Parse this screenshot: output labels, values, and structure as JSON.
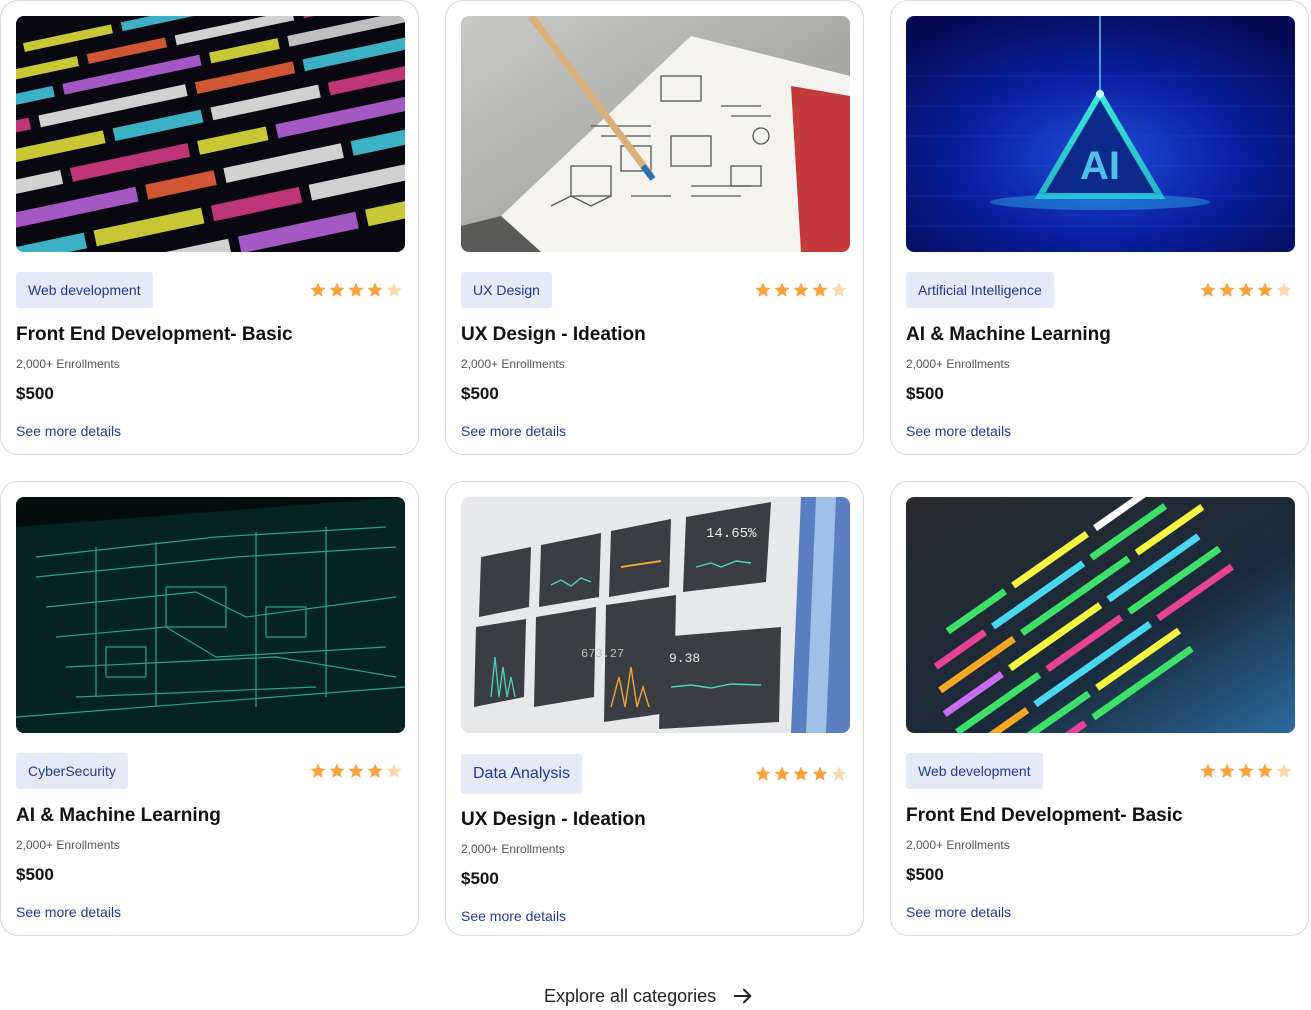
{
  "cards": [
    {
      "category": "Web development",
      "title": "Front End Development- Basic",
      "enrollments": "2,000+ Enrollments",
      "price": "$500",
      "link": "See more details",
      "rating": 4,
      "image": "code-screen-image"
    },
    {
      "category": "UX Design",
      "title": "UX Design - Ideation",
      "enrollments": "2,000+ Enrollments",
      "price": "$500",
      "link": "See more details",
      "rating": 4,
      "image": "sketchbook-image"
    },
    {
      "category": "Artificial Intelligence",
      "title": "AI & Machine Learning",
      "enrollments": "2,000+ Enrollments",
      "price": "$500",
      "link": "See more details",
      "rating": 4,
      "image": "ai-triangle-image"
    },
    {
      "category": "CyberSecurity",
      "title": "AI & Machine Learning",
      "enrollments": "2,000+ Enrollments",
      "price": "$500",
      "link": "See more details",
      "rating": 4,
      "image": "circuit-board-image"
    },
    {
      "category": "Data Analysis",
      "title": "UX Design - Ideation",
      "enrollments": "2,000+ Enrollments",
      "price": "$500",
      "link": "See more details",
      "rating": 4,
      "image": "dashboard-image"
    },
    {
      "category": "Web development",
      "title": "Front End Development- Basic",
      "enrollments": "2,000+ Enrollments",
      "price": "$500",
      "link": "See more details",
      "rating": 4,
      "image": "code-neon-image"
    }
  ],
  "footer": {
    "explore_label": "Explore all categories",
    "arrow_icon": "arrow-right-icon"
  },
  "ai_image_text": "AI",
  "colors": {
    "tag_bg": "#e6e9f6",
    "tag_text": "#1f3a93",
    "link": "#1f3a93",
    "star": "#f7a23b",
    "star_empty": "#fbd9b0"
  }
}
